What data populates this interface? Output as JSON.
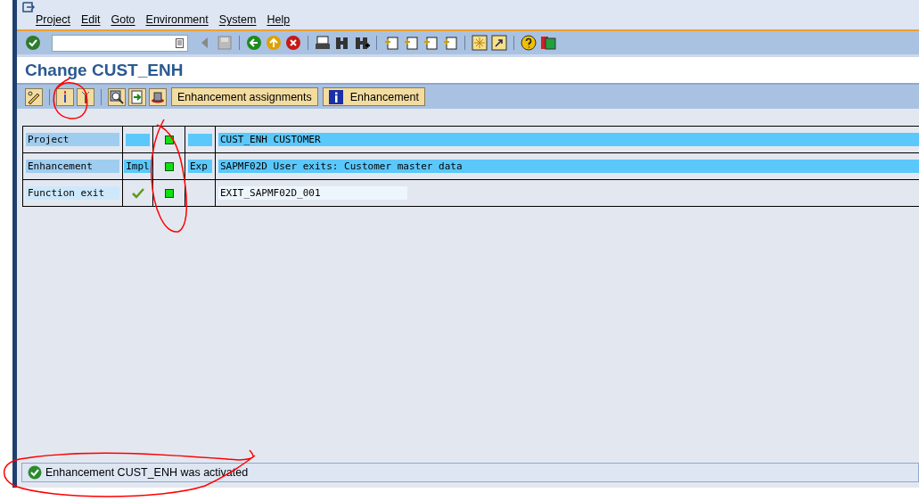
{
  "menu": [
    "Project",
    "Edit",
    "Goto",
    "Environment",
    "System",
    "Help"
  ],
  "title": "Change CUST_ENH",
  "app_buttons": [
    {
      "label": "Enhancement assignments"
    },
    {
      "label": "Enhancement"
    }
  ],
  "rows": [
    {
      "label": "Project",
      "highlighted": true,
      "checked": false,
      "value": "CUST_ENH CUSTOMER"
    },
    {
      "label": "Enhancement",
      "highlighted": true,
      "checked": false,
      "column_2": "Impl",
      "column_4": "Exp",
      "value": "SAPMF02D User exits: Customer master data"
    },
    {
      "label": "Function exit",
      "highlighted": false,
      "checked": true,
      "value": "EXIT_SAPMF02D_001"
    }
  ],
  "status_bar": {
    "message": "Enhancement CUST_ENH was activated"
  }
}
